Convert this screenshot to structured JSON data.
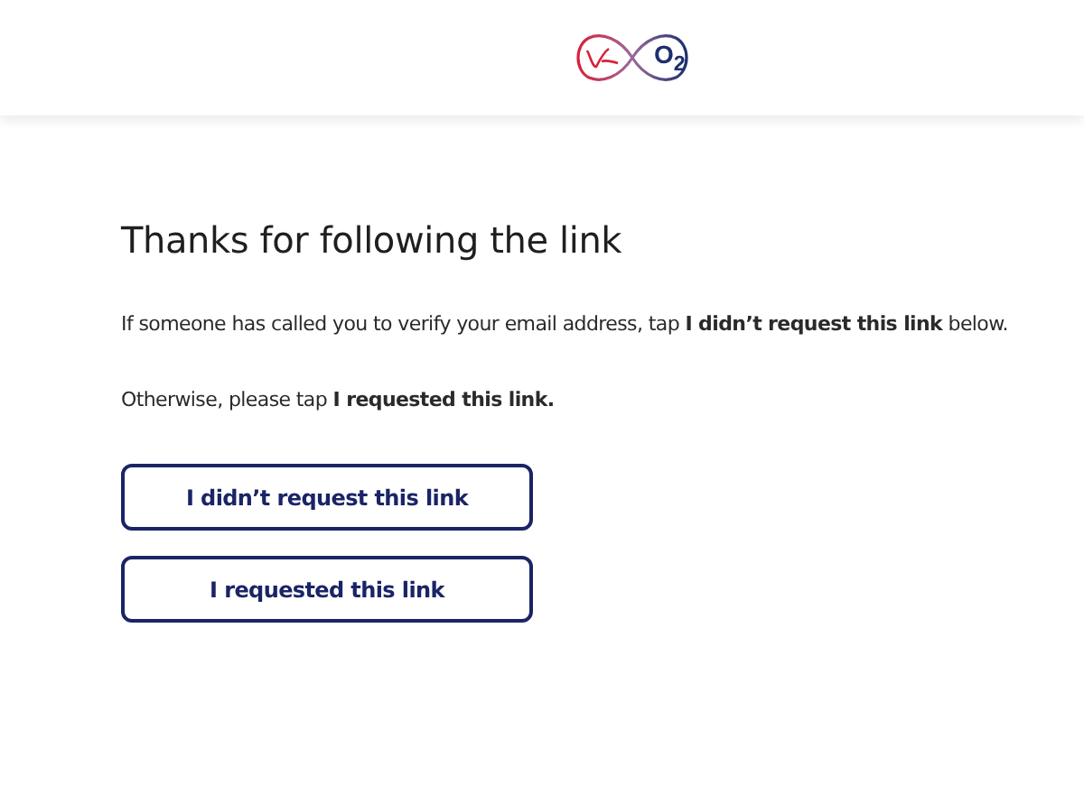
{
  "header": {
    "logo_text": "O$_{2}$"
  },
  "title": "Thanks for following the link",
  "paragraphs": [
    "If someone has called you to verify your email address, tap **I didn’t request this link** below.",
    "Otherwise, please tap **I requested this link.**"
  ],
  "buttons": [
    "I didn’t request this link",
    "I requested this link"
  ]
}
